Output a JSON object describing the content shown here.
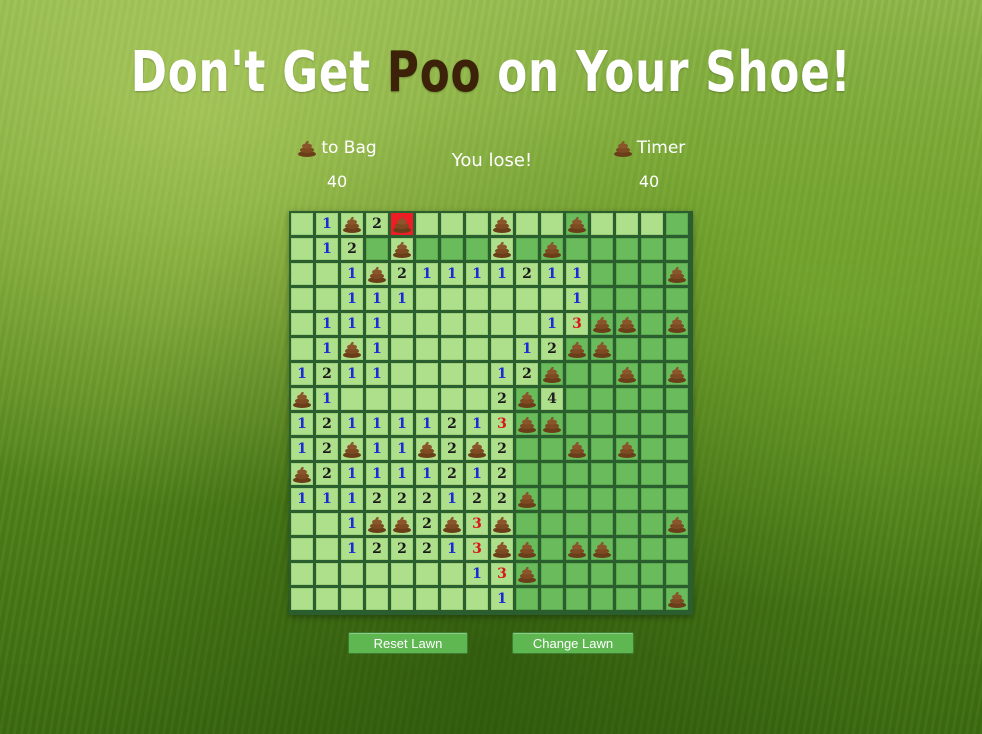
{
  "title": {
    "part1": "Don't Get ",
    "part2": "Poo",
    "part3": " on Your Shoe!"
  },
  "left_stat": {
    "label": "to Bag",
    "value": "40"
  },
  "right_stat": {
    "label": "Timer",
    "value": "40"
  },
  "status": "You lose!",
  "buttons": {
    "reset": "Reset Lawn",
    "change": "Change Lawn"
  },
  "colors": {
    "covered": "#6abb5b",
    "open": "#aedf8b",
    "exploded": "#ee1c24",
    "one": "#1a2ad6",
    "two": "#1a1a1a",
    "three": "#d9151b"
  },
  "icons": {
    "poo": "poo-icon"
  },
  "board": {
    "cols": 16,
    "rows": [
      [
        ".",
        "1",
        "P",
        "2",
        "X",
        ".",
        ".",
        ".",
        "P",
        ".",
        ".",
        "P",
        ".",
        ".",
        ".",
        " "
      ],
      [
        ".",
        "1",
        "2",
        "#",
        "P",
        "#",
        "#",
        "#",
        "P",
        "#",
        "P",
        "#",
        "#",
        "#",
        "#",
        "#"
      ],
      [
        ".",
        ".",
        "1",
        "P",
        "2",
        "1",
        "1",
        "1",
        "1",
        "2",
        "1",
        "1",
        "#",
        "#",
        "#",
        "P"
      ],
      [
        ".",
        ".",
        "1",
        "1",
        "1",
        ".",
        ".",
        ".",
        ".",
        ".",
        ".",
        "1",
        "#",
        "#",
        "#",
        "#"
      ],
      [
        ".",
        "1",
        "1",
        "1",
        ".",
        ".",
        ".",
        ".",
        ".",
        ".",
        "1",
        "3",
        "P",
        "P",
        "#",
        "P"
      ],
      [
        ".",
        "1",
        "P",
        "1",
        ".",
        ".",
        ".",
        ".",
        ".",
        "1",
        "2",
        "P",
        "P",
        "#",
        "#",
        "#"
      ],
      [
        "1",
        "2",
        "1",
        "1",
        ".",
        ".",
        ".",
        ".",
        "1",
        "2",
        "P",
        "#",
        "#",
        "P",
        "#",
        "P"
      ],
      [
        "P",
        "1",
        ".",
        ".",
        ".",
        ".",
        ".",
        ".",
        "2",
        "P",
        "4",
        "#",
        "#",
        "#",
        "#",
        "#"
      ],
      [
        "1",
        "2",
        "1",
        "1",
        "1",
        "1",
        "2",
        "1",
        "3",
        "P",
        "P",
        "#",
        "#",
        "#",
        "#",
        "#"
      ],
      [
        "1",
        "2",
        "P",
        "1",
        "1",
        "P",
        "2",
        "P",
        "2",
        "#",
        "#",
        "P",
        "#",
        "P",
        "#",
        "#"
      ],
      [
        "P",
        "2",
        "1",
        "1",
        "1",
        "1",
        "2",
        "1",
        "2",
        "#",
        "#",
        "#",
        "#",
        "#",
        "#",
        "#"
      ],
      [
        "1",
        "1",
        "1",
        "2",
        "2",
        "2",
        "1",
        "2",
        "2",
        "P",
        "#",
        "#",
        "#",
        "#",
        "#",
        "#"
      ],
      [
        ".",
        ".",
        "1",
        "P",
        "P",
        "2",
        "P",
        "3",
        "P",
        "#",
        "#",
        "#",
        "#",
        "#",
        "#",
        "P"
      ],
      [
        ".",
        ".",
        "1",
        "2",
        "2",
        "2",
        "1",
        "3",
        "P",
        "P",
        "#",
        "P",
        "P",
        "#",
        "#",
        "#"
      ],
      [
        ".",
        ".",
        ".",
        ".",
        ".",
        ".",
        ".",
        "1",
        "3",
        "P",
        "#",
        "#",
        "#",
        "#",
        "#",
        "#"
      ],
      [
        ".",
        ".",
        ".",
        ".",
        ".",
        ".",
        ".",
        ".",
        "1",
        "#",
        "#",
        "#",
        "#",
        "#",
        "#",
        "P"
      ]
    ]
  }
}
